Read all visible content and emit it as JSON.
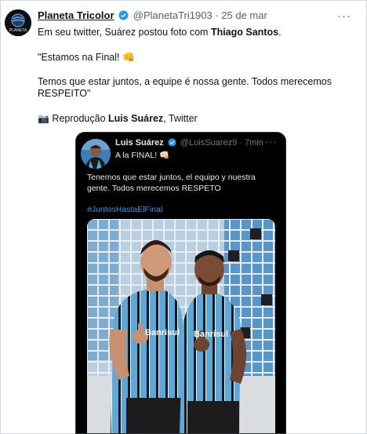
{
  "tweet": {
    "author_name": "Planeta Tricolor",
    "handle": "@PlanetaTri1903",
    "separator": "·",
    "date": "25 de mar",
    "avatar_text": "PLANETA",
    "line1_prefix": "Em seu twitter, Suárez postou foto com ",
    "line1_bold": "Thiago Santos",
    "line1_suffix": ".",
    "quote": "\"Estamos na Final! 👊",
    "para_line1": "Temos que estar juntos, a equipe é nossa gente. Todos merecemos",
    "para_line2": "RESPEITO\"",
    "credit_emoji": "📷",
    "credit_prefix": " Reprodução ",
    "credit_bold": "Luis Suárez",
    "credit_suffix": ", Twitter",
    "more_icon": "···"
  },
  "embedded": {
    "author_name": "Luis Suárez",
    "handle": "@LuisSuarez9",
    "separator": "·",
    "time": "7min",
    "line1": "A la FINAL! 👊🏻",
    "para_line1": "Tenemos que estar juntos, el equipo y nuestra",
    "para_line2": "gente. Todos merecemos RESPETO",
    "hashtag": "#JuntosHastaElFinal",
    "more_icon": "···"
  },
  "colors": {
    "verified": "#1d9bf0",
    "jersey_blue": "#5aa9dd",
    "tile_blue": "#4a90c8"
  },
  "photo": {
    "kit_sponsor": "Banrisul"
  }
}
